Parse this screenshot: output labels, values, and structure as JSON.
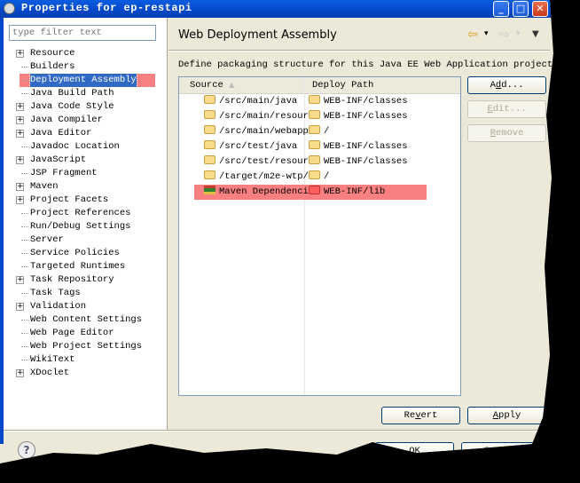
{
  "window": {
    "title": "Properties for ep-restapi",
    "minimize": "_",
    "maximize": "□",
    "close": "✕"
  },
  "filter": {
    "placeholder": "type filter text"
  },
  "tree": [
    {
      "label": "Resource",
      "expandable": true
    },
    {
      "label": "Builders",
      "expandable": false
    },
    {
      "label": "Deployment Assembly",
      "expandable": false,
      "selected": true
    },
    {
      "label": "Java Build Path",
      "expandable": false
    },
    {
      "label": "Java Code Style",
      "expandable": true
    },
    {
      "label": "Java Compiler",
      "expandable": true
    },
    {
      "label": "Java Editor",
      "expandable": true
    },
    {
      "label": "Javadoc Location",
      "expandable": false
    },
    {
      "label": "JavaScript",
      "expandable": true
    },
    {
      "label": "JSP Fragment",
      "expandable": false
    },
    {
      "label": "Maven",
      "expandable": true
    },
    {
      "label": "Project Facets",
      "expandable": true
    },
    {
      "label": "Project References",
      "expandable": false
    },
    {
      "label": "Run/Debug Settings",
      "expandable": false
    },
    {
      "label": "Server",
      "expandable": false
    },
    {
      "label": "Service Policies",
      "expandable": false
    },
    {
      "label": "Targeted Runtimes",
      "expandable": false
    },
    {
      "label": "Task Repository",
      "expandable": true
    },
    {
      "label": "Task Tags",
      "expandable": false
    },
    {
      "label": "Validation",
      "expandable": true
    },
    {
      "label": "Web Content Settings",
      "expandable": false
    },
    {
      "label": "Web Page Editor",
      "expandable": false
    },
    {
      "label": "Web Project Settings",
      "expandable": false
    },
    {
      "label": "WikiText",
      "expandable": false
    },
    {
      "label": "XDoclet",
      "expandable": true
    }
  ],
  "page": {
    "title": "Web Deployment Assembly",
    "description": "Define packaging structure for this Java EE Web Application project.",
    "nav": {
      "back": "⇦",
      "forward": "⇨",
      "menu": "▼",
      "dropdown": "▾"
    }
  },
  "table": {
    "columns": [
      "Source",
      "Deploy Path"
    ],
    "sort_indicator": "▲",
    "rows": [
      {
        "source": "/src/main/java",
        "deploy": "WEB-INF/classes",
        "icon": "folder-icon"
      },
      {
        "source": "/src/main/resour",
        "deploy": "WEB-INF/classes",
        "icon": "folder-icon"
      },
      {
        "source": "/src/main/webapp",
        "deploy": "/",
        "icon": "folder-icon"
      },
      {
        "source": "/src/test/java",
        "deploy": "WEB-INF/classes",
        "icon": "folder-icon"
      },
      {
        "source": "/src/test/resour",
        "deploy": "WEB-INF/classes",
        "icon": "folder-icon"
      },
      {
        "source": "/target/m2e-wtp/",
        "deploy": "/",
        "icon": "folder-icon"
      },
      {
        "source": "Maven Dependenci",
        "deploy": "WEB-INF/lib",
        "icon": "library-icon",
        "highlighted": true
      }
    ]
  },
  "buttons": {
    "add": {
      "pre": "A",
      "u": "d",
      "post": "d..."
    },
    "edit": {
      "pre": "",
      "u": "E",
      "post": "dit...",
      "enabled": false
    },
    "remove": {
      "pre": "",
      "u": "R",
      "post": "emove",
      "enabled": false
    },
    "revert": {
      "pre": "Re",
      "u": "v",
      "post": "ert"
    },
    "apply": {
      "pre": "",
      "u": "A",
      "post": "pply"
    },
    "ok": "OK",
    "cancel": "Cancel",
    "help": "?"
  },
  "colors": {
    "highlight": "#f88080",
    "selection": "#316ac5",
    "titlebar": "#0548c8"
  }
}
